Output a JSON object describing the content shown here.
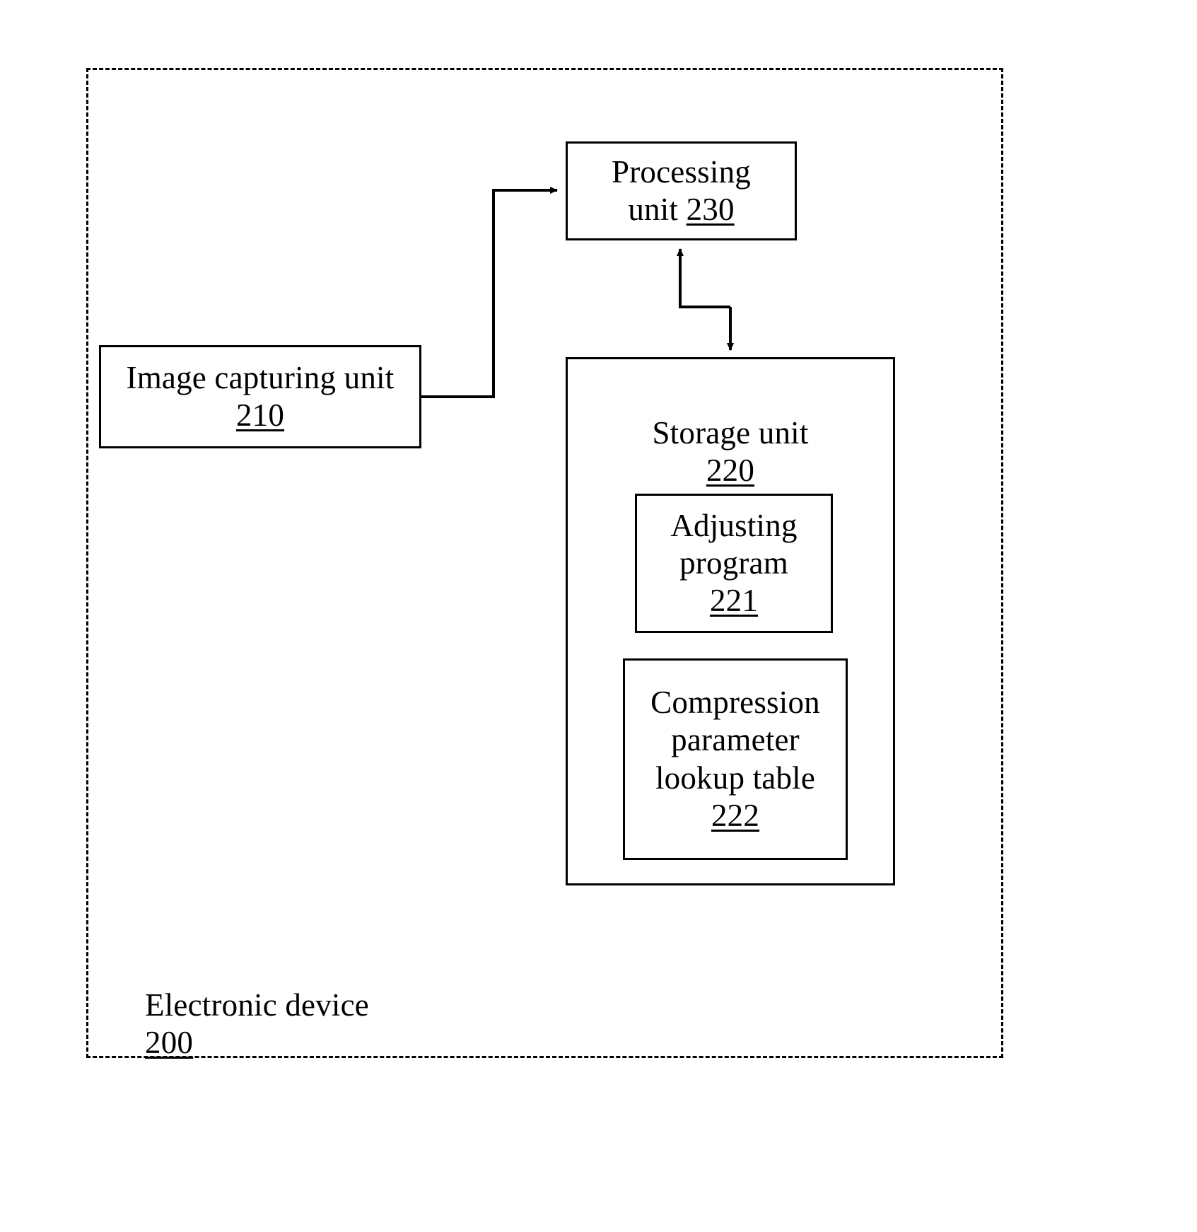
{
  "figure": {
    "type": "patent-block-diagram",
    "background_color": "#ffffff",
    "line_color": "#000000"
  },
  "device": {
    "name": "electronic-device",
    "label": "Electronic device",
    "ref": "200",
    "border_style": "dashed"
  },
  "blocks": {
    "processing_unit": {
      "label_line1": "Processing",
      "label_line2_prefix": "unit ",
      "ref": "230",
      "full_label": "Processing unit 230"
    },
    "image_capturing_unit": {
      "label": "Image capturing unit",
      "ref": "210",
      "full_label": "Image capturing unit 210"
    },
    "storage_unit": {
      "label": "Storage unit",
      "ref": "220",
      "full_label": "Storage unit 220"
    },
    "adjusting_program": {
      "label_line1": "Adjusting",
      "label_line2": "program",
      "ref": "221",
      "full_label": "Adjusting program 221"
    },
    "compression_lookup_table": {
      "label_line1": "Compression",
      "label_line2": "parameter",
      "label_line3": "lookup table",
      "ref": "222",
      "full_label": "Compression parameter lookup table 222"
    }
  },
  "connectors": [
    {
      "name": "capture-to-processing",
      "from": "image_capturing_unit",
      "to": "processing_unit",
      "arrowheads": "single",
      "style": "orthogonal"
    },
    {
      "name": "processing-storage-bidirectional",
      "from": "processing_unit",
      "to": "storage_unit",
      "arrowheads": "double",
      "style": "orthogonal"
    }
  ]
}
